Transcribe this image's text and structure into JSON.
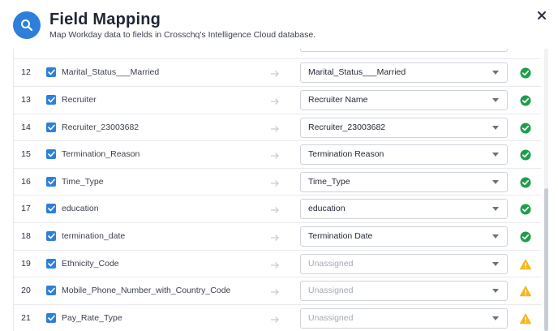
{
  "header": {
    "title": "Field Mapping",
    "subtitle": "Map Workday data to fields in Crosschq's Intelligence Cloud database."
  },
  "colors": {
    "accent": "#2e7fd9",
    "success": "#1e9e4a",
    "warning": "#f5b81c"
  },
  "rows": [
    {
      "num": "",
      "field": "",
      "mapped": "",
      "status": "none",
      "unassigned": false
    },
    {
      "num": "12",
      "field": "Marital_Status___Married",
      "mapped": "Marital_Status___Married",
      "status": "ok",
      "unassigned": false
    },
    {
      "num": "13",
      "field": "Recruiter",
      "mapped": "Recruiter Name",
      "status": "ok",
      "unassigned": false
    },
    {
      "num": "14",
      "field": "Recruiter_23003682",
      "mapped": "Recruiter_23003682",
      "status": "ok",
      "unassigned": false
    },
    {
      "num": "15",
      "field": "Termination_Reason",
      "mapped": "Termination Reason",
      "status": "ok",
      "unassigned": false
    },
    {
      "num": "16",
      "field": "Time_Type",
      "mapped": "Time_Type",
      "status": "ok",
      "unassigned": false
    },
    {
      "num": "17",
      "field": "education",
      "mapped": "education",
      "status": "ok",
      "unassigned": false
    },
    {
      "num": "18",
      "field": "termination_date",
      "mapped": "Termination Date",
      "status": "ok",
      "unassigned": false
    },
    {
      "num": "19",
      "field": "Ethnicity_Code",
      "mapped": "Unassigned",
      "status": "warning",
      "unassigned": true
    },
    {
      "num": "20",
      "field": "Mobile_Phone_Number_with_Country_Code",
      "mapped": "Unassigned",
      "status": "warning",
      "unassigned": true
    },
    {
      "num": "21",
      "field": "Pay_Rate_Type",
      "mapped": "Unassigned",
      "status": "warning",
      "unassigned": true
    }
  ]
}
